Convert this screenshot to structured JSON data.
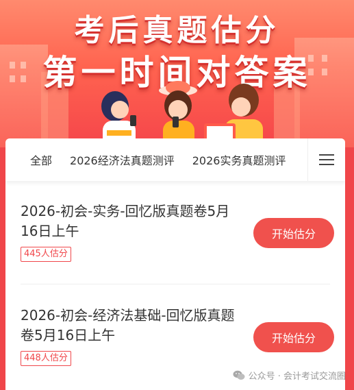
{
  "banner": {
    "title_line1": "考后真题估分",
    "title_line2": "第一时间对答案"
  },
  "tabs": [
    {
      "label": "全部"
    },
    {
      "label": "2026经济法真题测评"
    },
    {
      "label": "2026实务真题测评"
    }
  ],
  "menu": {
    "icon": "menu-icon"
  },
  "items": [
    {
      "title": "2026-初会-实务-回忆版真题卷5月16日上午",
      "count": "445人估分",
      "button": "开始估分"
    },
    {
      "title": "2026-初会-经济法基础-回忆版真题卷5月16日上午",
      "count": "448人估分",
      "button": "开始估分"
    }
  ],
  "watermark": {
    "text": "公众号 · 会计考试交流圈",
    "icon": "wechat-icon"
  },
  "colors": {
    "accent": "#f0514d",
    "banner": "#ff6450",
    "text": "#333333"
  }
}
